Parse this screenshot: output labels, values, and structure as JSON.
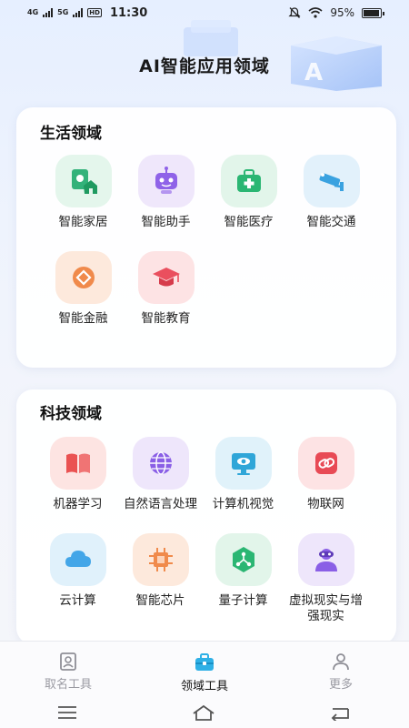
{
  "status": {
    "signal1": "4G",
    "signal2": "5G",
    "hd": "HD",
    "time": "11:30",
    "battery": "95%",
    "battery_level": 0.95
  },
  "page_title": "AI智能应用领域",
  "life": {
    "title": "生活领域",
    "items": [
      {
        "label": "智能家居",
        "icon": "smart-home-icon",
        "color": "#33b27a",
        "bg": "#e4f6ec"
      },
      {
        "label": "智能助手",
        "icon": "robot-assistant-icon",
        "color": "#8f63e8",
        "bg": "#efe7fb"
      },
      {
        "label": "智能医疗",
        "icon": "medical-kit-icon",
        "color": "#2bb673",
        "bg": "#e2f5ea"
      },
      {
        "label": "智能交通",
        "icon": "traffic-camera-icon",
        "color": "#3aa2e0",
        "bg": "#e2f1fb"
      },
      {
        "label": "智能金融",
        "icon": "finance-icon",
        "color": "#f08a4b",
        "bg": "#fde9dc"
      },
      {
        "label": "智能教育",
        "icon": "graduation-cap-icon",
        "color": "#ea4f5e",
        "bg": "#fde3e4"
      }
    ]
  },
  "tech": {
    "title": "科技领域",
    "items": [
      {
        "label": "机器学习",
        "icon": "book-icon",
        "color": "#ea5252",
        "bg": "#fde4e2"
      },
      {
        "label": "自然语言处理",
        "icon": "globe-icon",
        "color": "#8a5fe6",
        "bg": "#eee6fb"
      },
      {
        "label": "计算机视觉",
        "icon": "monitor-eye-icon",
        "color": "#2fa6d8",
        "bg": "#e0f2fa"
      },
      {
        "label": "物联网",
        "icon": "chain-link-icon",
        "color": "#e84a55",
        "bg": "#fde3e4"
      },
      {
        "label": "云计算",
        "icon": "cloud-icon",
        "color": "#43a6e8",
        "bg": "#e0f1fb"
      },
      {
        "label": "智能芯片",
        "icon": "chip-icon",
        "color": "#f08a4b",
        "bg": "#fde9dc"
      },
      {
        "label": "量子计算",
        "icon": "quantum-network-icon",
        "color": "#2bb673",
        "bg": "#e2f5ea"
      },
      {
        "label": "虚拟现实与增强现实",
        "icon": "vr-headset-icon",
        "color": "#8a5fe6",
        "bg": "#eee6fb"
      }
    ]
  },
  "nav": {
    "items": [
      {
        "label": "取名工具",
        "icon": "naming-book-icon",
        "active": false
      },
      {
        "label": "领域工具",
        "icon": "toolbox-icon",
        "active": true
      },
      {
        "label": "更多",
        "icon": "user-more-icon",
        "active": false
      }
    ]
  }
}
